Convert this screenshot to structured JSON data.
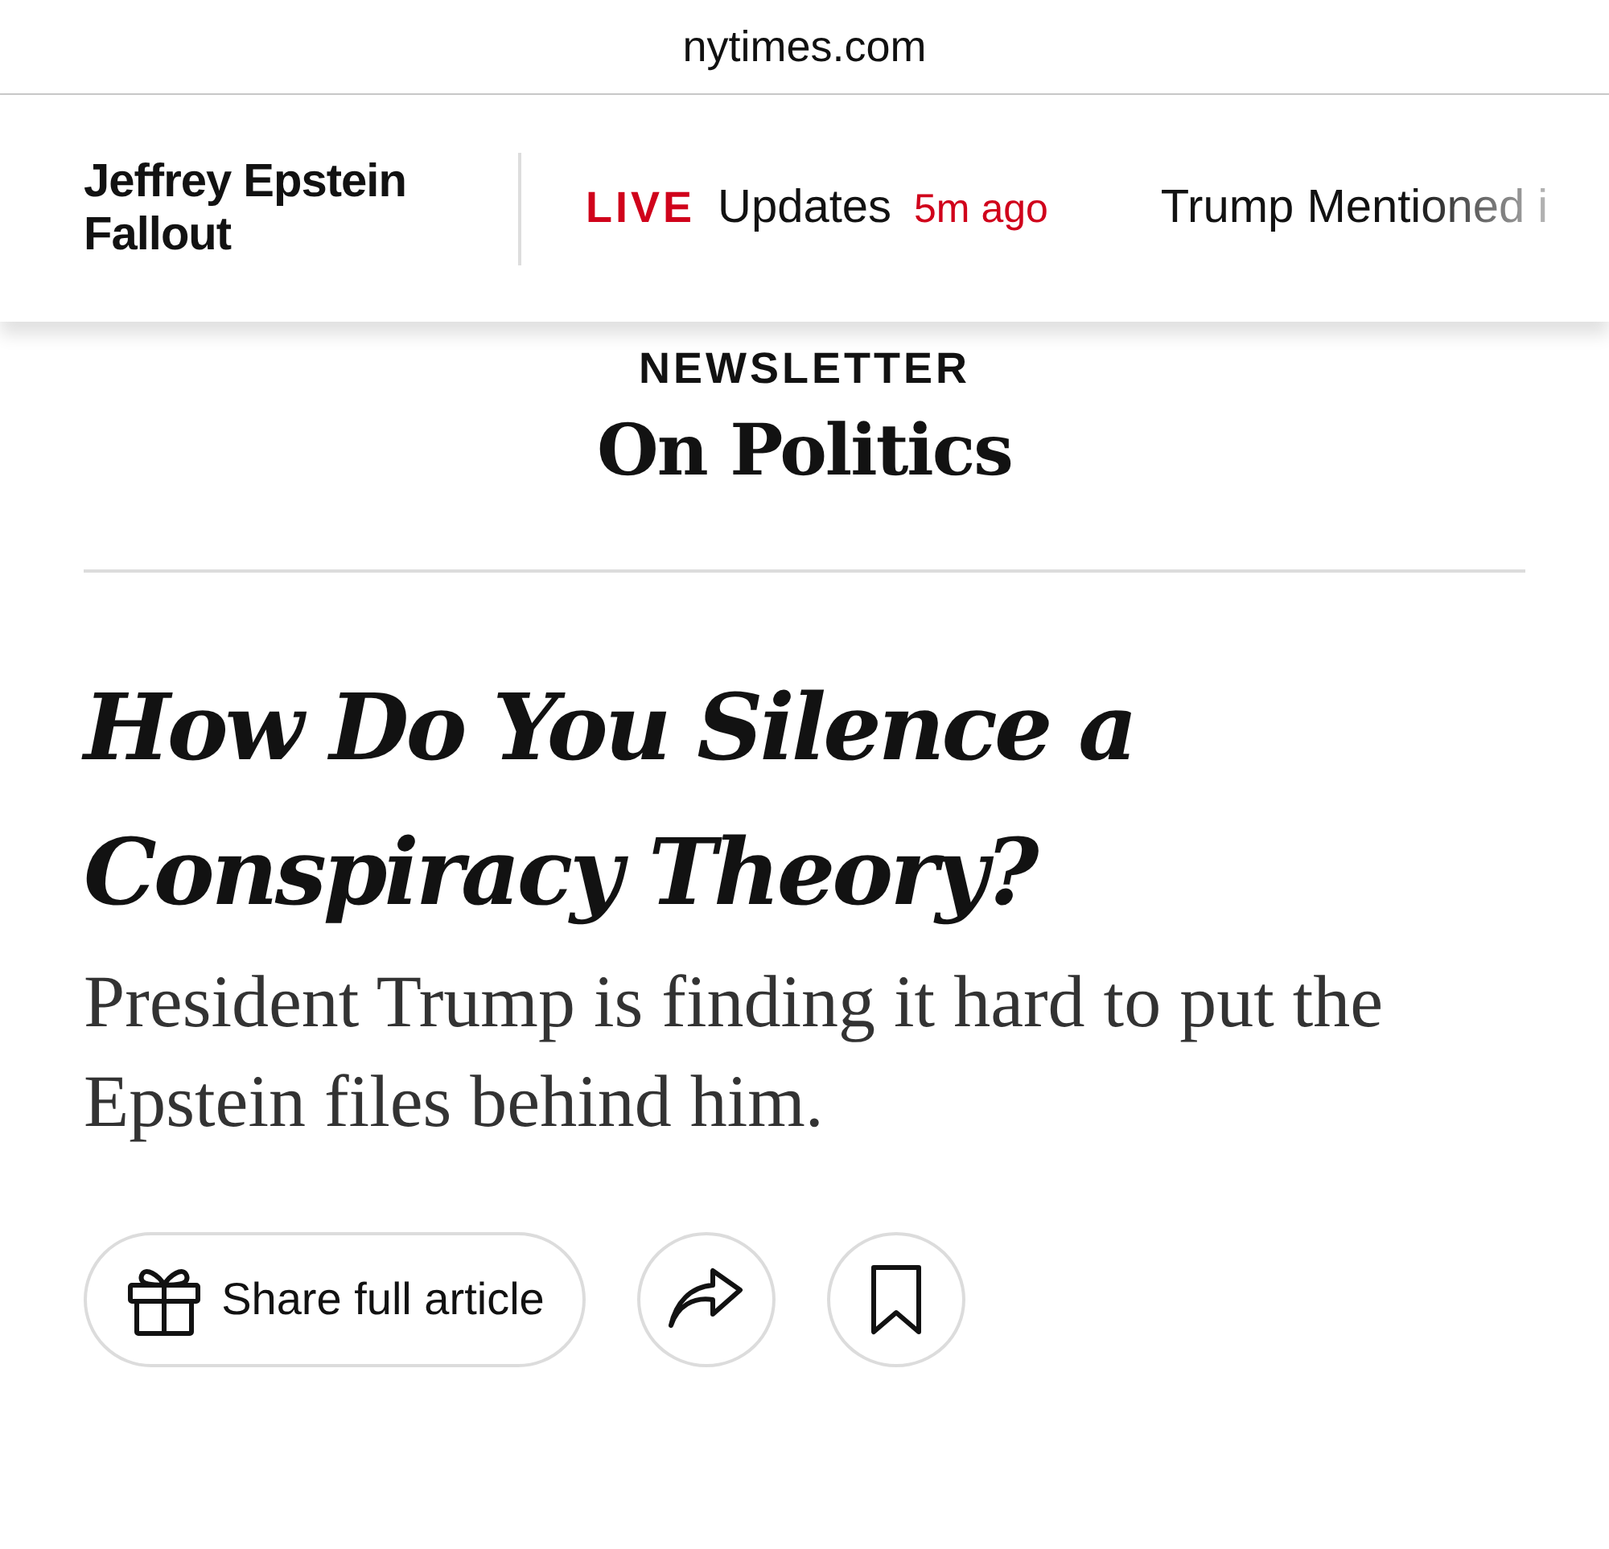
{
  "address_bar": {
    "url": "nytimes.com"
  },
  "topic_bar": {
    "title": "Jeffrey Epstein Fallout",
    "items": [
      {
        "kind": "live",
        "badge": "LIVE",
        "label": "Updates",
        "time": "5m ago"
      },
      {
        "kind": "link",
        "label": "Trump Mentioned i"
      }
    ]
  },
  "newsletter": {
    "label": "NEWSLETTER",
    "name": "On Politics"
  },
  "headline": "How Do You Silence a Conspiracy Theory?",
  "summary": "President Trump is finding it hard to put the Epstein files behind him.",
  "actions": [
    {
      "kind": "gift",
      "label": "Share full article"
    },
    {
      "kind": "share"
    },
    {
      "kind": "bookmark"
    }
  ]
}
